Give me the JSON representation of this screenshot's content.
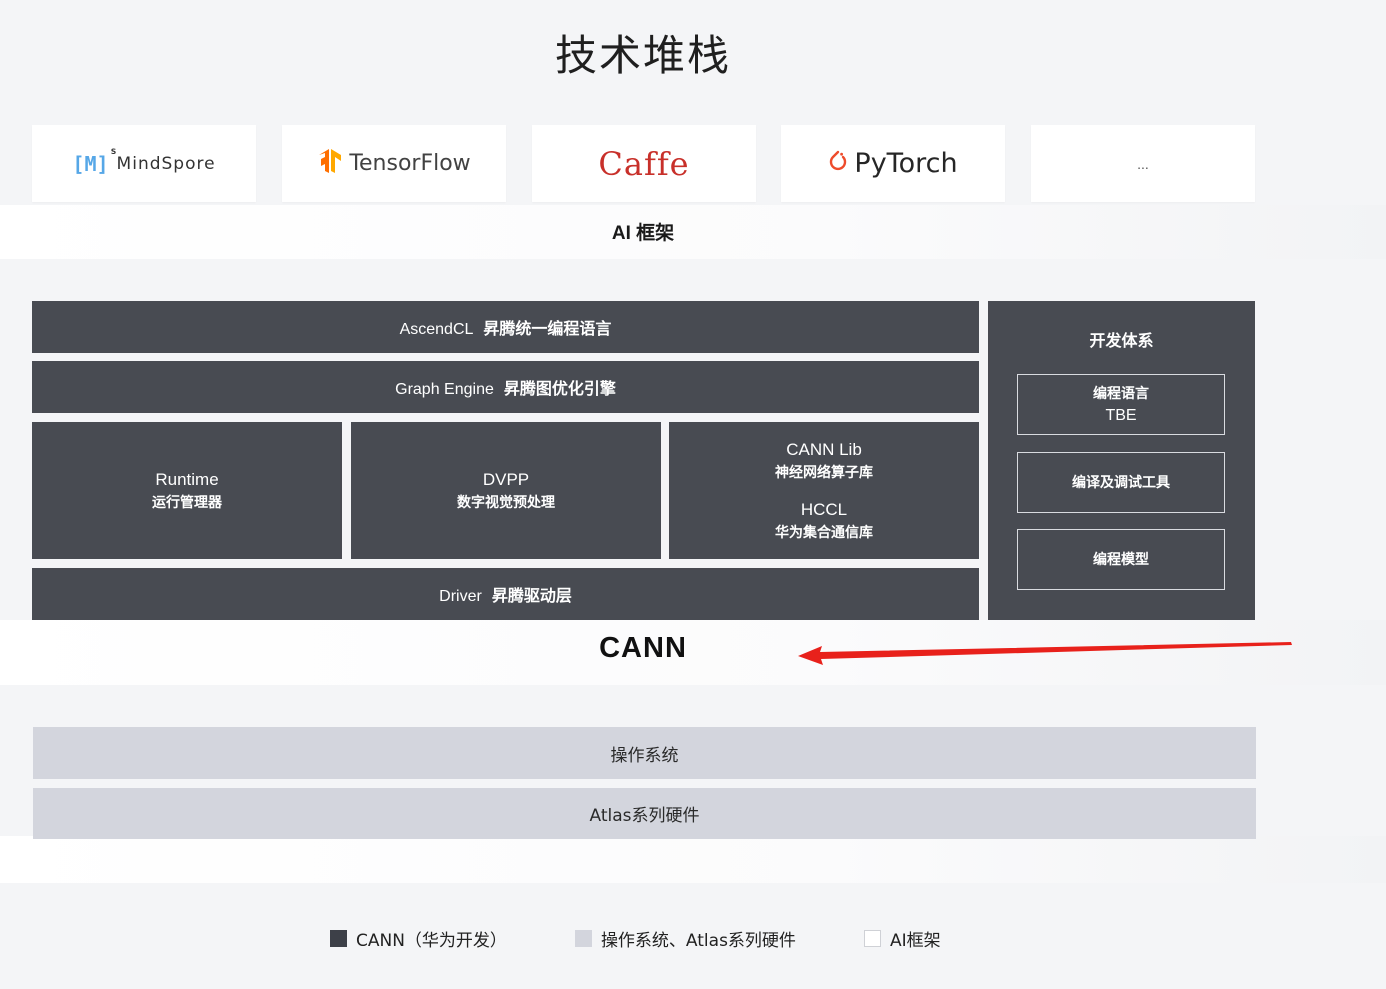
{
  "title": "技术堆栈",
  "ai_frameworks": {
    "items": [
      {
        "name": "MindSpore",
        "logo_mark": "[M]",
        "logo_sup": "s"
      },
      {
        "name": "TensorFlow"
      },
      {
        "name": "Caffe"
      },
      {
        "name": "PyTorch"
      },
      {
        "name": "..."
      }
    ],
    "band_label": "AI 框架"
  },
  "cann": {
    "ascendcl": {
      "en": "AscendCL",
      "zh": "昇腾统一编程语言"
    },
    "graph_engine": {
      "en": "Graph Engine",
      "zh": "昇腾图优化引擎"
    },
    "runtime": {
      "en": "Runtime",
      "zh": "运行管理器"
    },
    "dvpp": {
      "en": "DVPP",
      "zh": "数字视觉预处理"
    },
    "cann_lib": {
      "en": "CANN Lib",
      "zh": "神经网络算子库"
    },
    "hccl": {
      "en": "HCCL",
      "zh": "华为集合通信库"
    },
    "driver": {
      "en": "Driver",
      "zh": "昇腾驱动层"
    },
    "dev_system": {
      "title": "开发体系",
      "items": [
        {
          "zh": "编程语言",
          "en": "TBE"
        },
        {
          "zh": "编译及调试工具"
        },
        {
          "zh": "编程模型"
        }
      ]
    },
    "band_label": "CANN"
  },
  "os_layer": {
    "os": "操作系统",
    "atlas": "Atlas系列硬件"
  },
  "legend": {
    "cann": "CANN（华为开发）",
    "os_atlas": "操作系统、Atlas系列硬件",
    "ai": "AI框架"
  },
  "colors": {
    "dark_block": "#484b52",
    "light_block": "#d3d5dd",
    "arrow": "#e8211b",
    "caffe": "#c8302a",
    "tensorflow": "#ff8f00",
    "pytorch": "#ee4c2c",
    "mindspore": "#56a7e7"
  }
}
